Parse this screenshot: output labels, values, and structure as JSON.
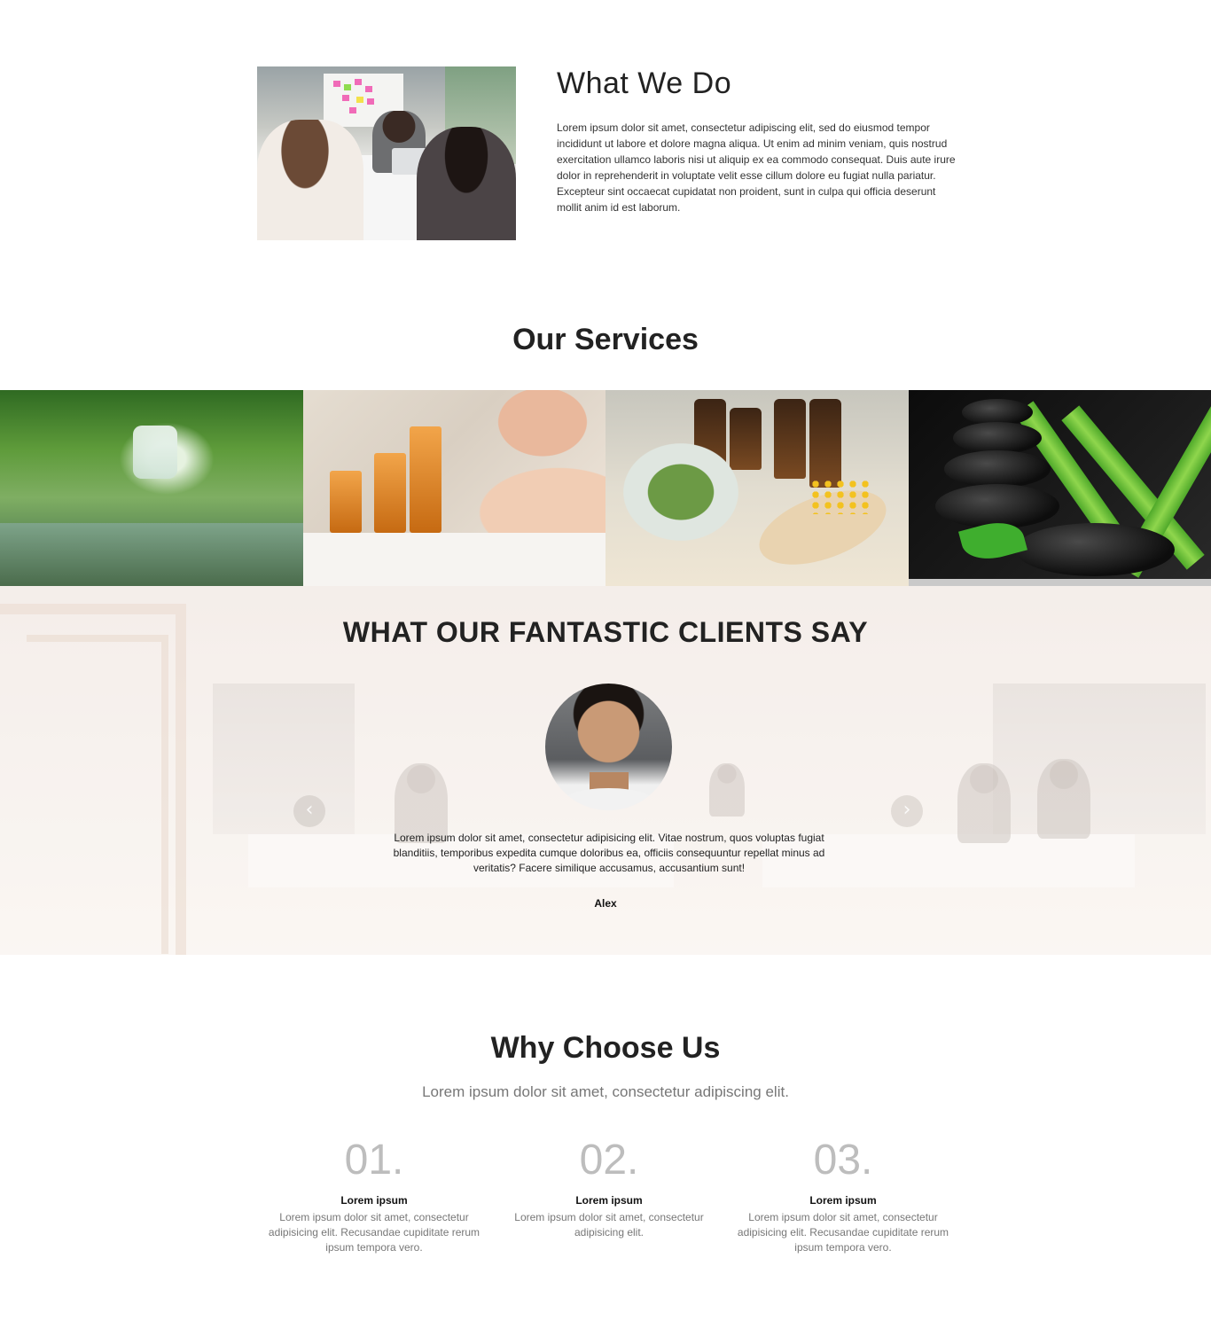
{
  "what_we_do": {
    "title": "What We Do",
    "text": "Lorem ipsum dolor sit amet, consectetur adipiscing elit, sed do eiusmod tempor incididunt ut labore et dolore magna aliqua. Ut enim ad minim veniam, quis nostrud exercitation ullamco laboris nisi ut aliquip ex ea commodo consequat. Duis aute irure dolor in reprehenderit in voluptate velit esse cillum dolore eu fugiat nulla pariatur. Excepteur sint occaecat cupidatat non proident, sunt in culpa qui officia deserunt mollit anim id est laborum."
  },
  "services": {
    "title": "Our Services"
  },
  "testimonials": {
    "title": "WHAT OUR FANTASTIC CLIENTS SAY",
    "quote": "Lorem ipsum dolor sit amet, consectetur adipisicing elit. Vitae nostrum, quos voluptas fugiat blanditiis, temporibus expedita cumque doloribus ea, officiis consequuntur repellat minus ad veritatis? Facere similique accusamus, accusantium sunt!",
    "name": "Alex",
    "prev_icon": "chevron-left-icon",
    "next_icon": "chevron-right-icon"
  },
  "why_choose_us": {
    "title": "Why Choose Us",
    "subtitle": "Lorem ipsum dolor sit amet, consectetur adipiscing elit.",
    "items": [
      {
        "number": "01.",
        "heading": "Lorem ipsum",
        "text": "Lorem ipsum dolor sit amet, consectetur adipisicing elit. Recusandae cupiditate rerum ipsum tempora vero."
      },
      {
        "number": "02.",
        "heading": "Lorem ipsum",
        "text": "Lorem ipsum dolor sit amet, consectetur adipisicing elit."
      },
      {
        "number": "03.",
        "heading": "Lorem ipsum",
        "text": "Lorem ipsum dolor sit amet, consectetur adipisicing elit. Recusandae cupiditate rerum ipsum tempora vero."
      }
    ]
  }
}
